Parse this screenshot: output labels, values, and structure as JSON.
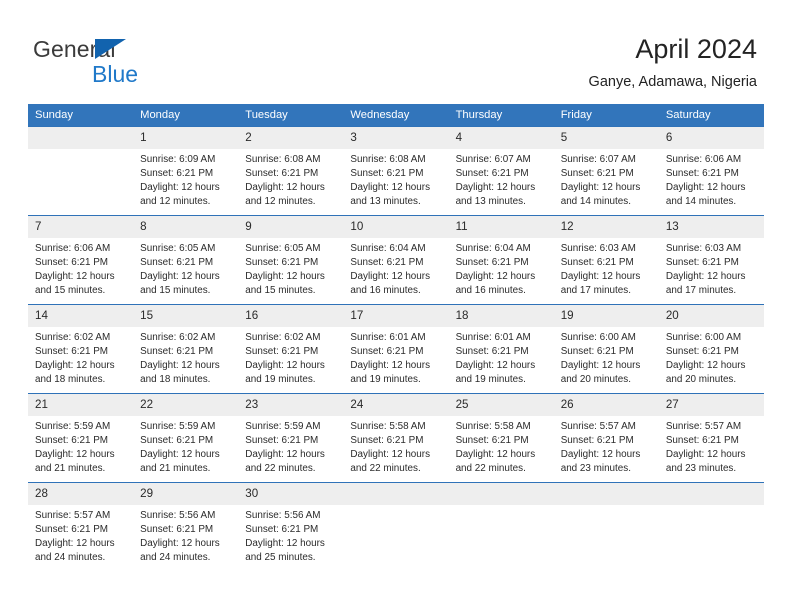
{
  "brand": {
    "name_top": "General",
    "name_bottom": "Blue",
    "accent": "#1263ae",
    "accent_text": "#2079c9"
  },
  "header": {
    "title": "April 2024",
    "subtitle": "Ganye, Adamawa, Nigeria"
  },
  "theme": {
    "header_row_bg": "#3275bb",
    "daynum_bg": "#eeeeee",
    "rule_color": "#2f72b8"
  },
  "weekdays": [
    "Sunday",
    "Monday",
    "Tuesday",
    "Wednesday",
    "Thursday",
    "Friday",
    "Saturday"
  ],
  "weeks": [
    [
      {
        "day": "",
        "blank": true,
        "sunrise": "",
        "sunset": "",
        "daylight1": "",
        "daylight2": ""
      },
      {
        "day": "1",
        "sunrise": "Sunrise: 6:09 AM",
        "sunset": "Sunset: 6:21 PM",
        "daylight1": "Daylight: 12 hours",
        "daylight2": "and 12 minutes."
      },
      {
        "day": "2",
        "sunrise": "Sunrise: 6:08 AM",
        "sunset": "Sunset: 6:21 PM",
        "daylight1": "Daylight: 12 hours",
        "daylight2": "and 12 minutes."
      },
      {
        "day": "3",
        "sunrise": "Sunrise: 6:08 AM",
        "sunset": "Sunset: 6:21 PM",
        "daylight1": "Daylight: 12 hours",
        "daylight2": "and 13 minutes."
      },
      {
        "day": "4",
        "sunrise": "Sunrise: 6:07 AM",
        "sunset": "Sunset: 6:21 PM",
        "daylight1": "Daylight: 12 hours",
        "daylight2": "and 13 minutes."
      },
      {
        "day": "5",
        "sunrise": "Sunrise: 6:07 AM",
        "sunset": "Sunset: 6:21 PM",
        "daylight1": "Daylight: 12 hours",
        "daylight2": "and 14 minutes."
      },
      {
        "day": "6",
        "sunrise": "Sunrise: 6:06 AM",
        "sunset": "Sunset: 6:21 PM",
        "daylight1": "Daylight: 12 hours",
        "daylight2": "and 14 minutes."
      }
    ],
    [
      {
        "day": "7",
        "sunrise": "Sunrise: 6:06 AM",
        "sunset": "Sunset: 6:21 PM",
        "daylight1": "Daylight: 12 hours",
        "daylight2": "and 15 minutes."
      },
      {
        "day": "8",
        "sunrise": "Sunrise: 6:05 AM",
        "sunset": "Sunset: 6:21 PM",
        "daylight1": "Daylight: 12 hours",
        "daylight2": "and 15 minutes."
      },
      {
        "day": "9",
        "sunrise": "Sunrise: 6:05 AM",
        "sunset": "Sunset: 6:21 PM",
        "daylight1": "Daylight: 12 hours",
        "daylight2": "and 15 minutes."
      },
      {
        "day": "10",
        "sunrise": "Sunrise: 6:04 AM",
        "sunset": "Sunset: 6:21 PM",
        "daylight1": "Daylight: 12 hours",
        "daylight2": "and 16 minutes."
      },
      {
        "day": "11",
        "sunrise": "Sunrise: 6:04 AM",
        "sunset": "Sunset: 6:21 PM",
        "daylight1": "Daylight: 12 hours",
        "daylight2": "and 16 minutes."
      },
      {
        "day": "12",
        "sunrise": "Sunrise: 6:03 AM",
        "sunset": "Sunset: 6:21 PM",
        "daylight1": "Daylight: 12 hours",
        "daylight2": "and 17 minutes."
      },
      {
        "day": "13",
        "sunrise": "Sunrise: 6:03 AM",
        "sunset": "Sunset: 6:21 PM",
        "daylight1": "Daylight: 12 hours",
        "daylight2": "and 17 minutes."
      }
    ],
    [
      {
        "day": "14",
        "sunrise": "Sunrise: 6:02 AM",
        "sunset": "Sunset: 6:21 PM",
        "daylight1": "Daylight: 12 hours",
        "daylight2": "and 18 minutes."
      },
      {
        "day": "15",
        "sunrise": "Sunrise: 6:02 AM",
        "sunset": "Sunset: 6:21 PM",
        "daylight1": "Daylight: 12 hours",
        "daylight2": "and 18 minutes."
      },
      {
        "day": "16",
        "sunrise": "Sunrise: 6:02 AM",
        "sunset": "Sunset: 6:21 PM",
        "daylight1": "Daylight: 12 hours",
        "daylight2": "and 19 minutes."
      },
      {
        "day": "17",
        "sunrise": "Sunrise: 6:01 AM",
        "sunset": "Sunset: 6:21 PM",
        "daylight1": "Daylight: 12 hours",
        "daylight2": "and 19 minutes."
      },
      {
        "day": "18",
        "sunrise": "Sunrise: 6:01 AM",
        "sunset": "Sunset: 6:21 PM",
        "daylight1": "Daylight: 12 hours",
        "daylight2": "and 19 minutes."
      },
      {
        "day": "19",
        "sunrise": "Sunrise: 6:00 AM",
        "sunset": "Sunset: 6:21 PM",
        "daylight1": "Daylight: 12 hours",
        "daylight2": "and 20 minutes."
      },
      {
        "day": "20",
        "sunrise": "Sunrise: 6:00 AM",
        "sunset": "Sunset: 6:21 PM",
        "daylight1": "Daylight: 12 hours",
        "daylight2": "and 20 minutes."
      }
    ],
    [
      {
        "day": "21",
        "sunrise": "Sunrise: 5:59 AM",
        "sunset": "Sunset: 6:21 PM",
        "daylight1": "Daylight: 12 hours",
        "daylight2": "and 21 minutes."
      },
      {
        "day": "22",
        "sunrise": "Sunrise: 5:59 AM",
        "sunset": "Sunset: 6:21 PM",
        "daylight1": "Daylight: 12 hours",
        "daylight2": "and 21 minutes."
      },
      {
        "day": "23",
        "sunrise": "Sunrise: 5:59 AM",
        "sunset": "Sunset: 6:21 PM",
        "daylight1": "Daylight: 12 hours",
        "daylight2": "and 22 minutes."
      },
      {
        "day": "24",
        "sunrise": "Sunrise: 5:58 AM",
        "sunset": "Sunset: 6:21 PM",
        "daylight1": "Daylight: 12 hours",
        "daylight2": "and 22 minutes."
      },
      {
        "day": "25",
        "sunrise": "Sunrise: 5:58 AM",
        "sunset": "Sunset: 6:21 PM",
        "daylight1": "Daylight: 12 hours",
        "daylight2": "and 22 minutes."
      },
      {
        "day": "26",
        "sunrise": "Sunrise: 5:57 AM",
        "sunset": "Sunset: 6:21 PM",
        "daylight1": "Daylight: 12 hours",
        "daylight2": "and 23 minutes."
      },
      {
        "day": "27",
        "sunrise": "Sunrise: 5:57 AM",
        "sunset": "Sunset: 6:21 PM",
        "daylight1": "Daylight: 12 hours",
        "daylight2": "and 23 minutes."
      }
    ],
    [
      {
        "day": "28",
        "sunrise": "Sunrise: 5:57 AM",
        "sunset": "Sunset: 6:21 PM",
        "daylight1": "Daylight: 12 hours",
        "daylight2": "and 24 minutes."
      },
      {
        "day": "29",
        "sunrise": "Sunrise: 5:56 AM",
        "sunset": "Sunset: 6:21 PM",
        "daylight1": "Daylight: 12 hours",
        "daylight2": "and 24 minutes."
      },
      {
        "day": "30",
        "sunrise": "Sunrise: 5:56 AM",
        "sunset": "Sunset: 6:21 PM",
        "daylight1": "Daylight: 12 hours",
        "daylight2": "and 25 minutes."
      },
      {
        "day": "",
        "blank": true,
        "sunrise": "",
        "sunset": "",
        "daylight1": "",
        "daylight2": ""
      },
      {
        "day": "",
        "blank": true,
        "sunrise": "",
        "sunset": "",
        "daylight1": "",
        "daylight2": ""
      },
      {
        "day": "",
        "blank": true,
        "sunrise": "",
        "sunset": "",
        "daylight1": "",
        "daylight2": ""
      },
      {
        "day": "",
        "blank": true,
        "sunrise": "",
        "sunset": "",
        "daylight1": "",
        "daylight2": ""
      }
    ]
  ]
}
